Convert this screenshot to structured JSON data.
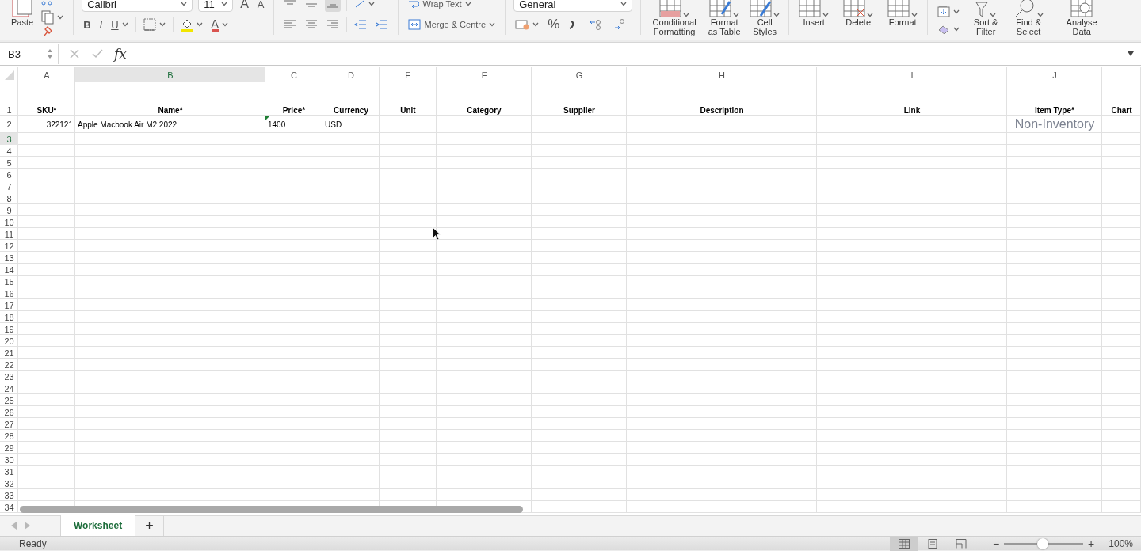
{
  "ribbon": {
    "clipboard": {
      "paste": "Paste"
    },
    "font": {
      "name": "Calibri",
      "size": "11",
      "grow": "A",
      "shrink": "A",
      "bold": "B",
      "italic": "I",
      "underline": "U",
      "font_color": "A"
    },
    "alignment": {
      "wrap_text": "Wrap Text",
      "merge": "Merge & Centre"
    },
    "number": {
      "format": "General",
      "percent": "%"
    },
    "styles": [
      {
        "label": "Conditional Formatting"
      },
      {
        "label": "Format as Table"
      },
      {
        "label": "Cell Styles"
      }
    ],
    "cells": [
      {
        "label": "Insert"
      },
      {
        "label": "Delete"
      },
      {
        "label": "Format"
      }
    ],
    "editing": [
      {
        "label": "Sort & Filter"
      },
      {
        "label": "Find & Select"
      }
    ],
    "analysis": [
      {
        "label": "Analyse Data"
      }
    ]
  },
  "formula_bar": {
    "name_box": "B3",
    "fx": "fx"
  },
  "sheet": {
    "columns": [
      {
        "letter": "A",
        "selected": false
      },
      {
        "letter": "B",
        "selected": true
      },
      {
        "letter": "C",
        "selected": false
      },
      {
        "letter": "D",
        "selected": false
      },
      {
        "letter": "E",
        "selected": false
      },
      {
        "letter": "F",
        "selected": false
      },
      {
        "letter": "G",
        "selected": false
      },
      {
        "letter": "H",
        "selected": false
      },
      {
        "letter": "I",
        "selected": false
      },
      {
        "letter": "J",
        "selected": false
      },
      {
        "selected": false
      }
    ],
    "rows": [
      {
        "number": "1",
        "selected": false,
        "cells": [
          {
            "text": "SKU*",
            "kind": "header"
          },
          {
            "text": "Name*",
            "kind": "header"
          },
          {
            "text": "Price*",
            "kind": "header"
          },
          {
            "text": "Currency",
            "kind": "header"
          },
          {
            "text": "Unit",
            "kind": "header"
          },
          {
            "text": "Category",
            "kind": "header"
          },
          {
            "text": "Supplier",
            "kind": "header"
          },
          {
            "text": "Description",
            "kind": "header"
          },
          {
            "text": "Link",
            "kind": "header"
          },
          {
            "text": "Item Type*",
            "kind": "header"
          },
          {
            "text": "Chart",
            "kind": "header"
          }
        ]
      },
      {
        "number": "2",
        "selected": false,
        "cells": [
          {
            "text": "322121",
            "kind": "number"
          },
          {
            "text": "Apple Macbook Air M2 2022",
            "kind": "text"
          },
          {
            "text": "1400",
            "kind": "text",
            "error_flag": true
          },
          {
            "text": "USD",
            "kind": "text"
          },
          null,
          null,
          null,
          null,
          null,
          {
            "text": "Non-Inventory",
            "kind": "styled"
          }
        ]
      },
      {
        "number": "3",
        "selected": true
      },
      {
        "number": "4",
        "selected": false
      },
      {
        "number": "5",
        "selected": false
      },
      {
        "number": "6",
        "selected": false
      },
      {
        "number": "7",
        "selected": false
      },
      {
        "number": "8",
        "selected": false
      },
      {
        "number": "9",
        "selected": false
      },
      {
        "number": "10",
        "selected": false
      },
      {
        "number": "11",
        "selected": false
      },
      {
        "number": "12",
        "selected": false
      },
      {
        "number": "13",
        "selected": false
      },
      {
        "number": "14",
        "selected": false
      },
      {
        "number": "15",
        "selected": false
      },
      {
        "number": "16",
        "selected": false
      },
      {
        "number": "17",
        "selected": false
      },
      {
        "number": "18",
        "selected": false
      },
      {
        "number": "19",
        "selected": false
      },
      {
        "number": "20",
        "selected": false
      },
      {
        "number": "21",
        "selected": false
      },
      {
        "number": "22",
        "selected": false
      },
      {
        "number": "23",
        "selected": false
      },
      {
        "number": "24",
        "selected": false
      },
      {
        "number": "25",
        "selected": false
      },
      {
        "number": "26",
        "selected": false
      },
      {
        "number": "27",
        "selected": false
      },
      {
        "number": "28",
        "selected": false
      },
      {
        "number": "29",
        "selected": false
      },
      {
        "number": "30",
        "selected": false
      },
      {
        "number": "31",
        "selected": false
      },
      {
        "number": "32",
        "selected": false
      },
      {
        "number": "33",
        "selected": false
      },
      {
        "number": "34",
        "selected": false
      }
    ]
  },
  "sheet_tabs": {
    "tabs": [
      {
        "name": "Worksheet",
        "selected": true
      }
    ],
    "add": "+"
  },
  "status_bar": {
    "status": "Ready",
    "views": [
      {
        "selected": true
      },
      {
        "selected": false
      },
      {
        "selected": false
      }
    ],
    "zoom_out": "−",
    "zoom_in": "+",
    "zoom": {
      "level": 0.49
    },
    "zoom_label": "100%"
  }
}
